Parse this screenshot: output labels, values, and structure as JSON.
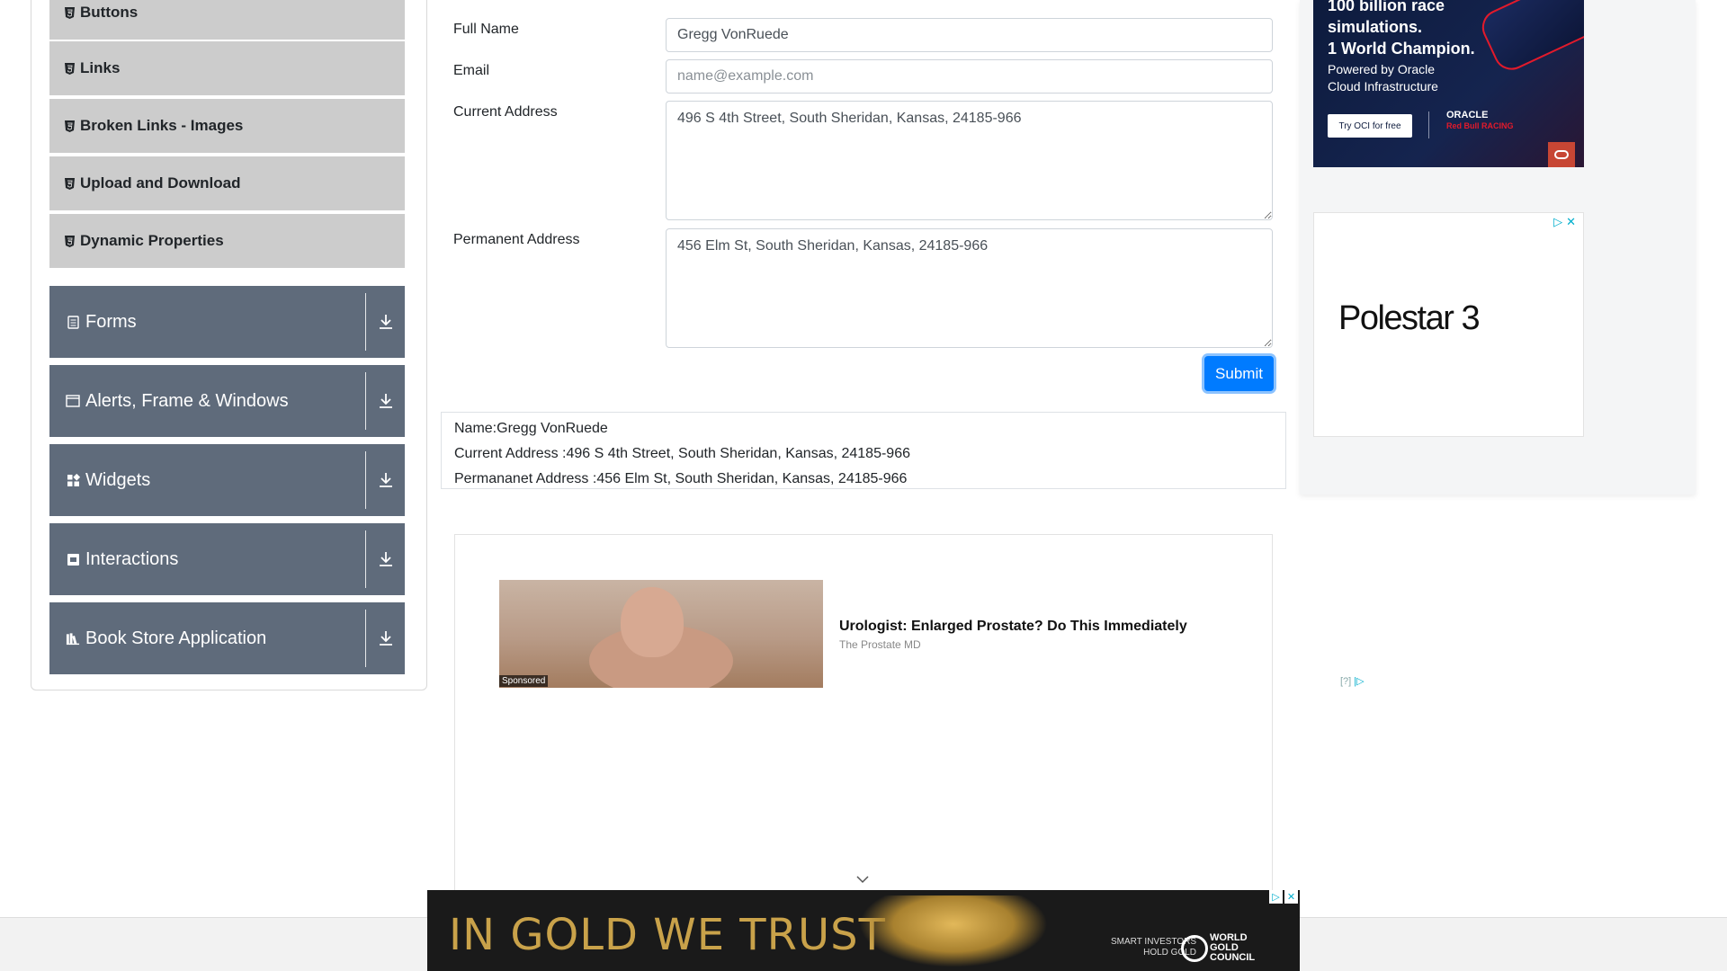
{
  "sidebar": {
    "elements_items": [
      {
        "label": "Buttons"
      },
      {
        "label": "Links"
      },
      {
        "label": "Broken Links - Images"
      },
      {
        "label": "Upload and Download"
      },
      {
        "label": "Dynamic Properties"
      }
    ],
    "groups": [
      {
        "label": "Forms",
        "icon": "document-icon"
      },
      {
        "label": "Alerts, Frame & Windows",
        "icon": "window-icon"
      },
      {
        "label": "Widgets",
        "icon": "widgets-icon"
      },
      {
        "label": "Interactions",
        "icon": "interactions-icon"
      },
      {
        "label": "Book Store Application",
        "icon": "books-icon"
      }
    ]
  },
  "form": {
    "full_name_label": "Full Name",
    "full_name_value": "Gregg VonRuede",
    "email_label": "Email",
    "email_placeholder": "name@example.com",
    "current_address_label": "Current Address",
    "current_address_value": "496 S 4th Street, South Sheridan, Kansas, 24185-966",
    "permanent_address_label": "Permanent Address",
    "permanent_address_value": "456 Elm St, South Sheridan, Kansas, 24185-966",
    "submit_label": "Submit"
  },
  "output": {
    "name": "Name:Gregg VonRuede",
    "current_address": "Current Address :496 S 4th Street, South Sheridan, Kansas, 24185-966",
    "permanent_address": "Permananet Address :456 Elm St, South Sheridan, Kansas, 24185-966"
  },
  "ads": {
    "oracle": {
      "line1": "100 billion race",
      "line2": "simulations.",
      "line3": "1 World Champion.",
      "powered1": "Powered by Oracle",
      "powered2": "Cloud Infrastructure",
      "cta": "Try OCI for free",
      "brand": "ORACLE",
      "brand_sub": "Red Bull RACING"
    },
    "polestar": {
      "text": "Polestar 3"
    },
    "sponsored": {
      "label": "Sponsored",
      "title": "Urologist: Enlarged Prostate? Do This Immediately",
      "source": "The Prostate MD",
      "mark": "[?]"
    },
    "gold": {
      "headline": "IN GOLD WE TRUST",
      "tagline1": "SMART INVESTORS",
      "tagline2": "HOLD GOLD",
      "brand1": "WORLD",
      "brand2": "GOLD",
      "brand3": "COUNCIL"
    }
  },
  "colors": {
    "sidebar_group_bg": "#5f6b7b",
    "sidebar_item_bg": "#cccccc",
    "primary": "#007bff"
  }
}
